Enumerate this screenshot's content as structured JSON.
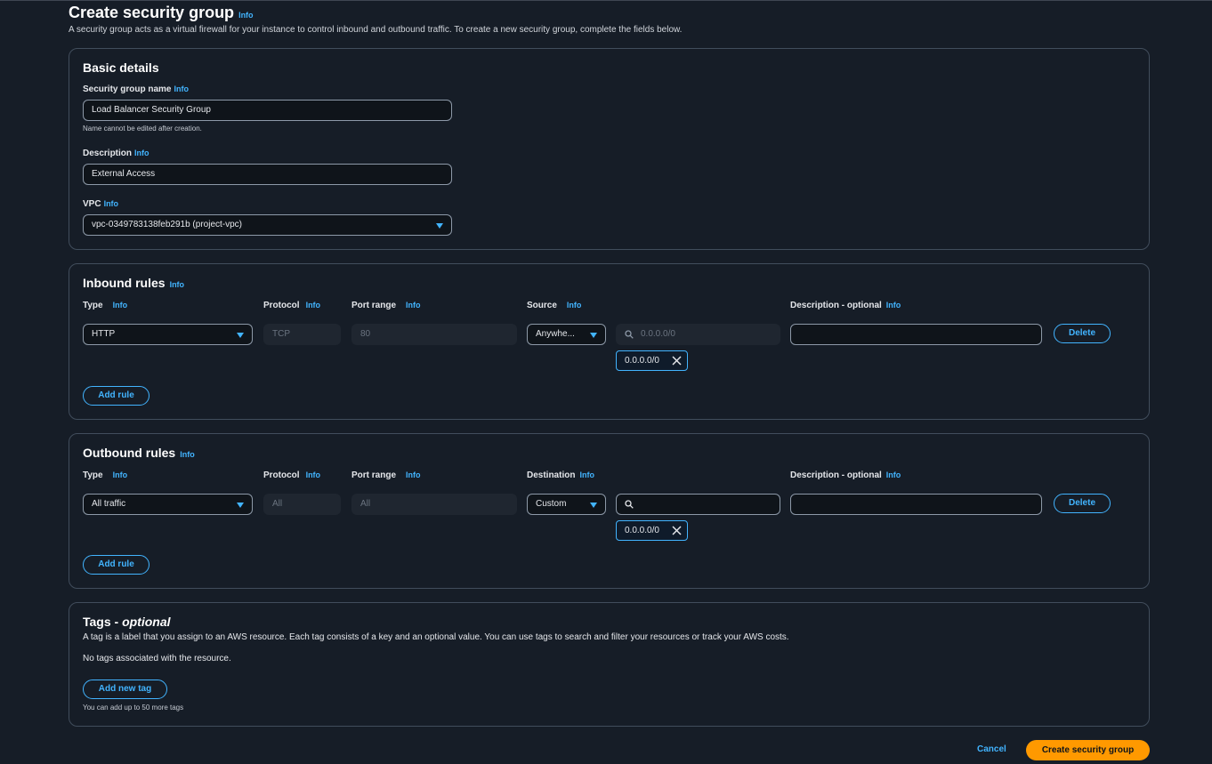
{
  "header": {
    "title": "Create security group",
    "info": "Info",
    "description": "A security group acts as a virtual firewall for your instance to control inbound and outbound traffic. To create a new security group, complete the fields below."
  },
  "basic": {
    "title": "Basic details",
    "name_label": "Security group name",
    "name_info": "Info",
    "name_value": "Load Balancer Security Group",
    "name_hint": "Name cannot be edited after creation.",
    "desc_label": "Description",
    "desc_info": "Info",
    "desc_value": "External Access",
    "vpc_label": "VPC",
    "vpc_info": "Info",
    "vpc_value": "vpc-0349783138feb291b (project-vpc)"
  },
  "inbound": {
    "title": "Inbound rules",
    "info": "Info",
    "col_type": "Type",
    "col_protocol": "Protocol",
    "col_port": "Port range",
    "col_source": "Source",
    "col_desc": "Description - optional",
    "col_info": "Info",
    "rule": {
      "type": "HTTP",
      "protocol": "TCP",
      "port": "80",
      "source": "Anywhe...",
      "search_placeholder": "0.0.0.0/0",
      "token": "0.0.0.0/0",
      "description": ""
    },
    "delete": "Delete",
    "add_rule": "Add rule"
  },
  "outbound": {
    "title": "Outbound rules",
    "info": "Info",
    "col_type": "Type",
    "col_protocol": "Protocol",
    "col_port": "Port range",
    "col_dest": "Destination",
    "col_desc": "Description - optional",
    "col_info": "Info",
    "rule": {
      "type": "All traffic",
      "protocol": "All",
      "port": "All",
      "destination": "Custom",
      "search_value": "",
      "token": "0.0.0.0/0",
      "description": ""
    },
    "delete": "Delete",
    "add_rule": "Add rule"
  },
  "tags": {
    "title": "Tags - ",
    "title_optional": "optional",
    "description": "A tag is a label that you assign to an AWS resource. Each tag consists of a key and an optional value. You can use tags to search and filter your resources or track your AWS costs.",
    "empty": "No tags associated with the resource.",
    "add": "Add new tag",
    "hint": "You can add up to 50 more tags"
  },
  "footer": {
    "cancel": "Cancel",
    "create": "Create security group"
  },
  "colors": {
    "background": "#161d27",
    "accent": "#42b4ff",
    "primary": "#ff9900"
  },
  "icons": [
    "info-link",
    "chevron-down-icon",
    "search-icon",
    "close-icon"
  ]
}
